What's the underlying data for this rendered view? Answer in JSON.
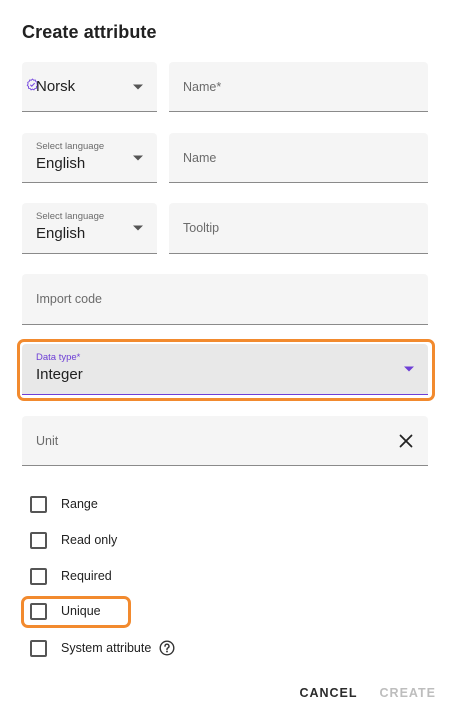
{
  "dialog": {
    "title": "Create attribute"
  },
  "row1": {
    "language": "Norsk",
    "name_placeholder": "Name*"
  },
  "row2": {
    "language_label": "Select language",
    "language": "English",
    "name_placeholder": "Name"
  },
  "row3": {
    "language_label": "Select language",
    "language": "English",
    "tooltip_placeholder": "Tooltip"
  },
  "import_code": {
    "placeholder": "Import code"
  },
  "data_type": {
    "label": "Data type*",
    "value": "Integer"
  },
  "unit": {
    "placeholder": "Unit"
  },
  "checkboxes": [
    {
      "label": "Range",
      "checked": false
    },
    {
      "label": "Read only",
      "checked": false
    },
    {
      "label": "Required",
      "checked": false
    },
    {
      "label": "Unique",
      "checked": false
    },
    {
      "label": "System attribute",
      "checked": false
    }
  ],
  "actions": {
    "cancel": "CANCEL",
    "create": "CREATE"
  },
  "colors": {
    "accent": "#6e3fd6",
    "highlight": "#f28a2e",
    "disabled": "#bdbdbd"
  },
  "icons": {
    "language_flag": "verified-badge-icon",
    "unit_clear": "close-icon",
    "system_help": "help-circle-icon"
  }
}
